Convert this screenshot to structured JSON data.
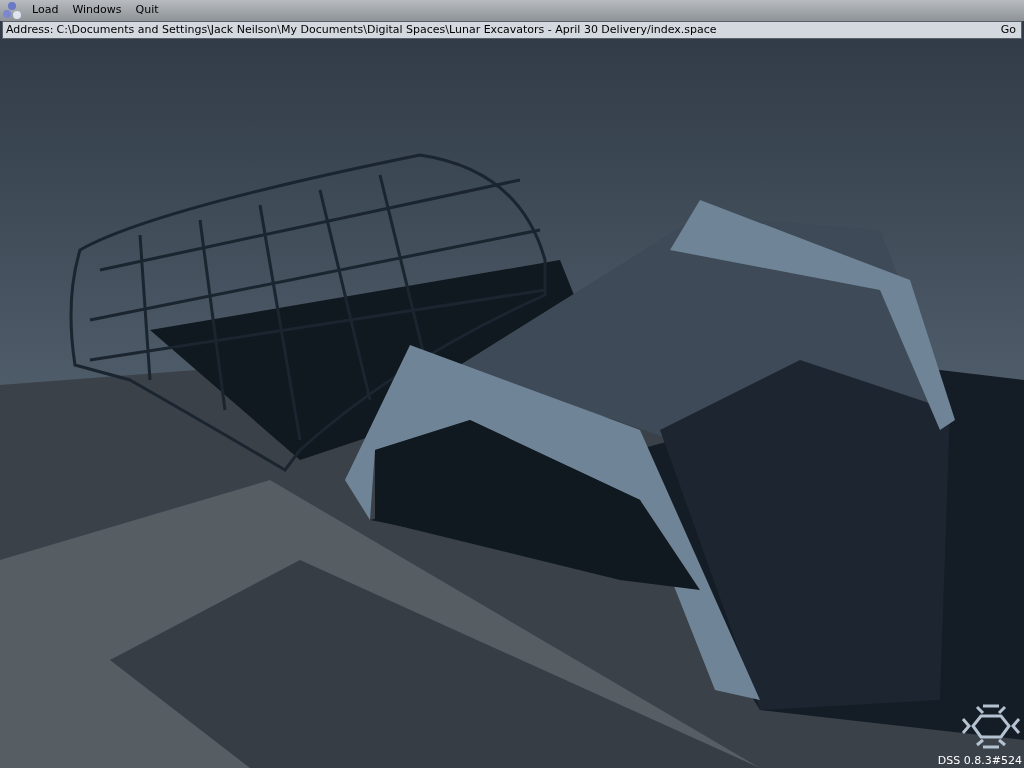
{
  "menu_bar": {
    "items": [
      {
        "label": "Load"
      },
      {
        "label": "Windows"
      },
      {
        "label": "Quit"
      }
    ]
  },
  "address_bar": {
    "label": "Address:",
    "value": "C:\\Documents and Settings\\Jack Neilson\\My Documents\\Digital Spaces\\Lunar Excavators - April 30 Delivery/index.space",
    "go": "Go"
  },
  "status": {
    "version": "DSS 0.8.3#524"
  }
}
